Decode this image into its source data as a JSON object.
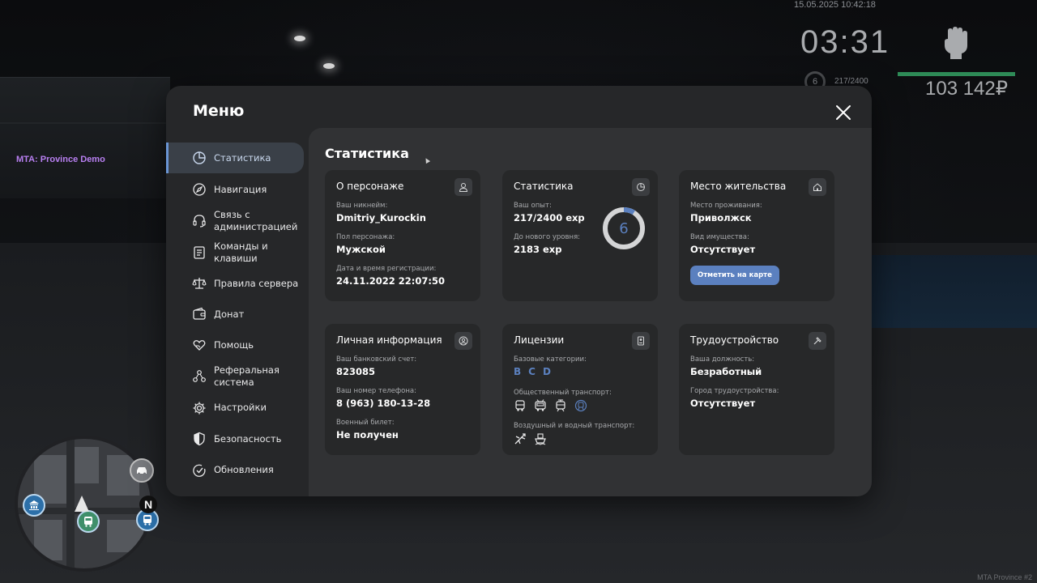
{
  "hud": {
    "datetime": "15.05.2025 10:42:18",
    "clock": "03:31",
    "level": "6",
    "exp": "217/2400",
    "money": "103 142₽",
    "health_fraction": 1.0,
    "server_tag": "MTA: Province Demo",
    "watermark": "MTA Province #2",
    "map_north": "N"
  },
  "menu": {
    "title": "Меню",
    "sidebar": [
      {
        "label": "Статистика",
        "icon": "pie-chart-icon",
        "active": true
      },
      {
        "label": "Навигация",
        "icon": "compass-icon"
      },
      {
        "label": "Связь с администрацией",
        "icon": "headset-icon"
      },
      {
        "label": "Команды и клавиши",
        "icon": "document-icon"
      },
      {
        "label": "Правила сервера",
        "icon": "scales-icon"
      },
      {
        "label": "Донат",
        "icon": "wallet-icon"
      },
      {
        "label": "Помощь",
        "icon": "heart-hand-icon"
      },
      {
        "label": "Реферальная система",
        "icon": "referral-icon"
      },
      {
        "label": "Настройки",
        "icon": "gear-icon"
      },
      {
        "label": "Безопасность",
        "icon": "shield-icon"
      },
      {
        "label": "Обновления",
        "icon": "check-circle-icon"
      }
    ]
  },
  "content": {
    "title": "Статистика",
    "cards": {
      "character": {
        "title": "О персонаже",
        "nickname_label": "Ваш никнейм:",
        "nickname": "Dmitriy_Kurockin",
        "gender_label": "Пол персонажа:",
        "gender": "Мужской",
        "reg_label": "Дата и время регистрации:",
        "reg_date": "24.11.2022 22:07:50"
      },
      "stats": {
        "title": "Статистика",
        "exp_label": "Ваш опыт:",
        "exp": "217/2400 exp",
        "next_label": "До нового уровня:",
        "next": "2183 exp",
        "level": "6",
        "level_progress": 0.09
      },
      "residence": {
        "title": "Место жительства",
        "place_label": "Место проживания:",
        "place": "Приволжск",
        "property_label": "Вид имущества:",
        "property": "Отсутствует",
        "button": "Отметить на карте"
      },
      "personal": {
        "title": "Личная информация",
        "bank_label": "Ваш банковский счет:",
        "bank": "823085",
        "phone_label": "Ваш номер телефона:",
        "phone": "8 (963) 180-13-28",
        "military_label": "Военный билет:",
        "military": "Не получен"
      },
      "licenses": {
        "title": "Лицензии",
        "base_label": "Базовые категории:",
        "categories": [
          "B",
          "C",
          "D"
        ],
        "public_label": "Общественный транспорт:",
        "public_icons": [
          "bus-icon",
          "trolleybus-icon",
          "tram-icon",
          "metro-icon"
        ],
        "air_label": "Воздушный и водный транспорт:",
        "air_icons": [
          "plane-icon",
          "boat-icon"
        ]
      },
      "job": {
        "title": "Трудоустройство",
        "position_label": "Ваша должность:",
        "position": "Безработный",
        "city_label": "Город трудоустройства:",
        "city": "Отсутствует"
      }
    }
  },
  "colors": {
    "accent": "#5b80bf",
    "panel": "#262729",
    "content": "#313234",
    "card": "#272829",
    "health": "#2e8b57"
  }
}
